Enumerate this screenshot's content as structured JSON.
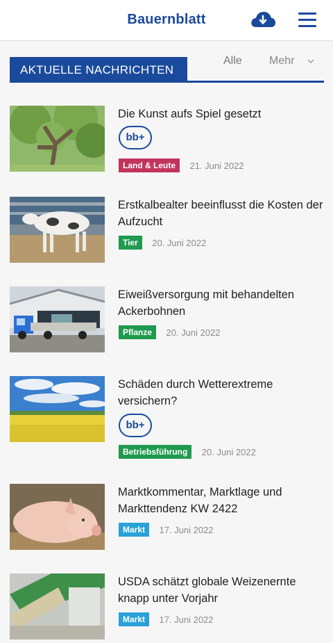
{
  "header": {
    "brand": "Bauernblatt",
    "cloud_icon": "cloud-download-icon",
    "menu_icon": "hamburger-menu-icon"
  },
  "section": {
    "title": "AKTUELLE NACHRICHTEN",
    "filter_all": "Alle",
    "filter_more": "Mehr"
  },
  "badge_label": "bb+",
  "colors": {
    "brand": "#1a4a9b",
    "land_leute": "#c2345c",
    "tier": "#1f9a4e",
    "pflanze": "#1f9a4e",
    "betrieb": "#1f9a4e",
    "markt": "#2aa1d8"
  },
  "articles": [
    {
      "title": "Die Kunst aufs Spiel gesetzt",
      "bbplus": true,
      "tag": "Land & Leute",
      "date": "21. Juni 2022"
    },
    {
      "title": "Erstkalbealter beeinflusst die Kosten der Aufzucht",
      "bbplus": false,
      "tag": "Tier",
      "date": "20. Juni 2022"
    },
    {
      "title": "Eiweißversorgung mit behandelten Ackerbohnen",
      "bbplus": false,
      "tag": "Pflanze",
      "date": "20. Juni 2022"
    },
    {
      "title": "Schäden durch Wetterextreme versichern?",
      "bbplus": true,
      "tag": "Betriebsführung",
      "date": "20. Juni 2022"
    },
    {
      "title": "Marktkommentar, Marktlage und Markttendenz KW 2422",
      "bbplus": false,
      "tag": "Markt",
      "date": "17. Juni 2022"
    },
    {
      "title": "USDA schätzt globale Weizenernte knapp unter Vorjahr",
      "bbplus": false,
      "tag": "Markt",
      "date": "17. Juni 2022"
    }
  ]
}
